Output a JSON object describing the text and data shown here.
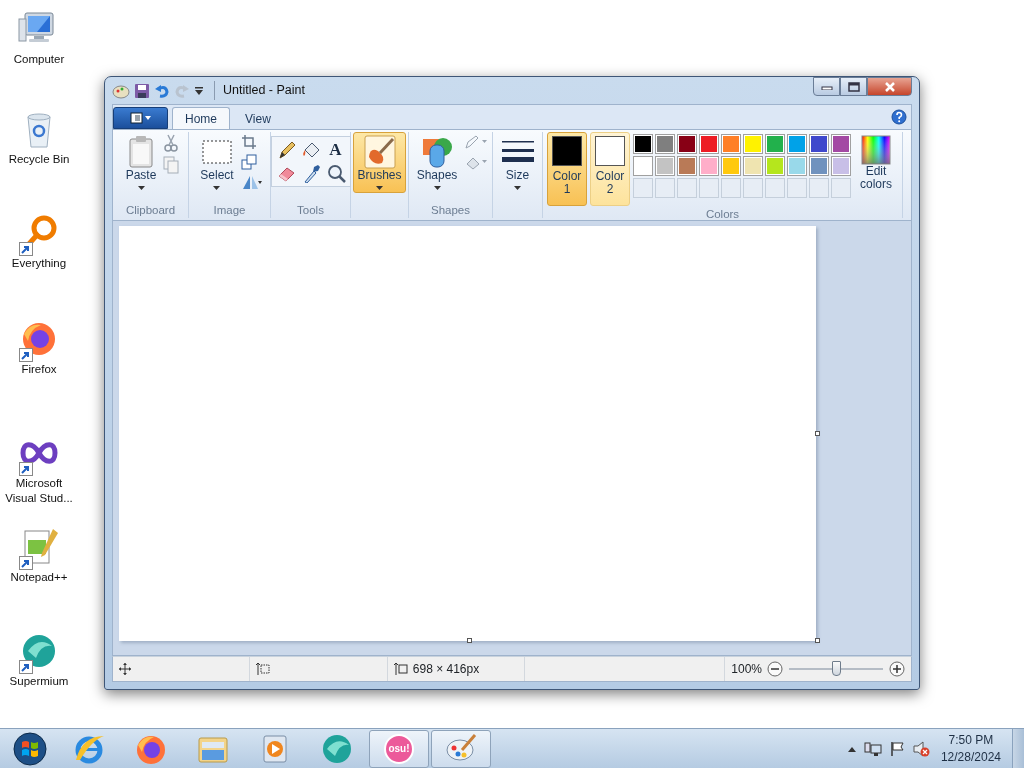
{
  "desktop_icons": [
    {
      "kind": "computer",
      "label": "Computer",
      "shortcut": false
    },
    {
      "kind": "recycle",
      "label": "Recycle Bin",
      "shortcut": false
    },
    {
      "kind": "everything",
      "label": "Everything",
      "shortcut": true
    },
    {
      "kind": "firefox",
      "label": "Firefox",
      "shortcut": true
    },
    {
      "kind": "vs",
      "label": "Microsoft Visual Stud...",
      "shortcut": true
    },
    {
      "kind": "notepad",
      "label": "Notepad++",
      "shortcut": true
    },
    {
      "kind": "supermium",
      "label": "Supermium",
      "shortcut": true
    }
  ],
  "window": {
    "title": "Untitled - Paint"
  },
  "ribbon": {
    "tabs": [
      {
        "label": "Home",
        "selected": true
      },
      {
        "label": "View",
        "selected": false
      }
    ],
    "clipboard": {
      "paste": "Paste",
      "group": "Clipboard"
    },
    "image": {
      "select": "Select",
      "group": "Image"
    },
    "tools": {
      "text_glyph": "A",
      "group": "Tools"
    },
    "brushes": {
      "label": "Brushes",
      "selected": true
    },
    "shapes": {
      "label": "Shapes",
      "group": "Shapes"
    },
    "size": {
      "label": "Size"
    },
    "colors": {
      "group": "Colors",
      "edit": "Edit colors",
      "slots": [
        {
          "label": "Color 1",
          "color": "#000000",
          "selected": true
        },
        {
          "label": "Color 2",
          "color": "#ffffff",
          "selected": false
        }
      ],
      "palette": [
        {
          "color": "#000000"
        },
        {
          "color": "#7f7f7f"
        },
        {
          "color": "#880015"
        },
        {
          "color": "#ed1c24"
        },
        {
          "color": "#ff7f27"
        },
        {
          "color": "#fff200"
        },
        {
          "color": "#22b14c"
        },
        {
          "color": "#00a2e8"
        },
        {
          "color": "#3f48cc"
        },
        {
          "color": "#a349a4"
        },
        {
          "color": "#ffffff"
        },
        {
          "color": "#c3c3c3"
        },
        {
          "color": "#b97a57"
        },
        {
          "color": "#ffaec9"
        },
        {
          "color": "#ffc90e"
        },
        {
          "color": "#efe4b0"
        },
        {
          "color": "#b5e61d"
        },
        {
          "color": "#99d9ea"
        },
        {
          "color": "#7092be"
        },
        {
          "color": "#c8bfe7"
        }
      ]
    }
  },
  "status_bar": {
    "canvas_size": "698 × 416px",
    "zoom": "100%",
    "zoom_slider": {
      "level": 0.5
    }
  },
  "taskbar": {
    "items": [
      {
        "kind": "start",
        "running": false
      },
      {
        "kind": "ie",
        "running": false
      },
      {
        "kind": "firefox",
        "running": false
      },
      {
        "kind": "explorer",
        "running": false
      },
      {
        "kind": "media",
        "running": false
      },
      {
        "kind": "supermium",
        "running": false
      },
      {
        "kind": "osu",
        "label": "osu!",
        "running": true
      },
      {
        "kind": "paint",
        "running": true
      }
    ],
    "time": "7:50 PM",
    "date": "12/28/2024",
    "volume_muted": true
  }
}
